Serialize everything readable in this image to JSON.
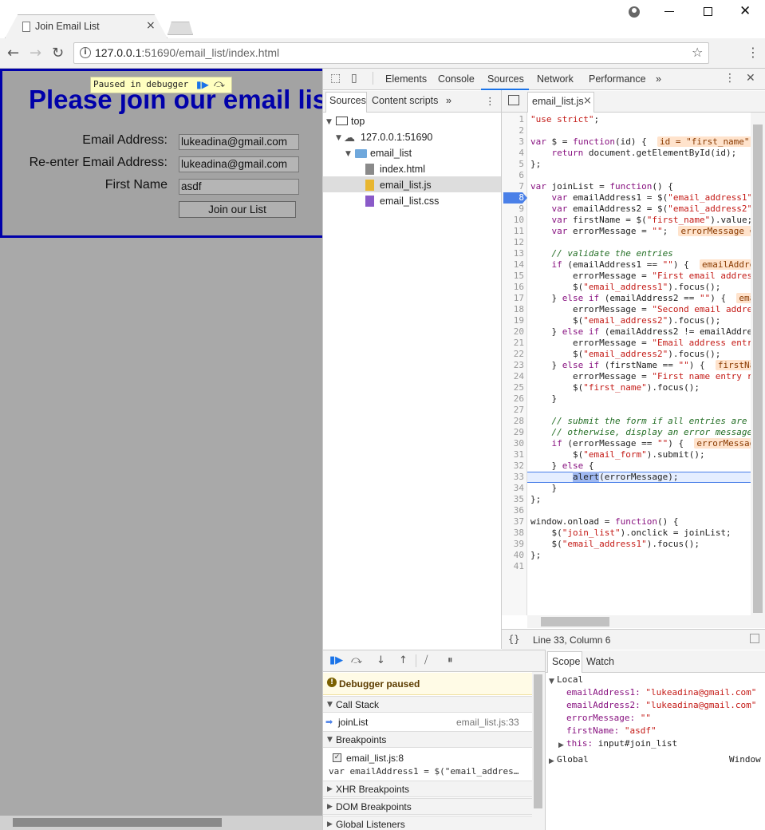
{
  "browser": {
    "tab_title": "Join Email List",
    "tab_close": "×",
    "url_host": "127.0.0.1",
    "url_rest": ":51690/email_list/index.html"
  },
  "page": {
    "heading": "Please join our email list",
    "overlay_text": "Paused in debugger",
    "fields": [
      {
        "label": "Email Address:",
        "value": "lukeadina@gmail.com"
      },
      {
        "label": "Re-enter Email Address:",
        "value": "lukeadina@gmail.com"
      },
      {
        "label": "First Name",
        "value": "asdf"
      }
    ],
    "button": "Join our List"
  },
  "devtools": {
    "tabs": [
      "Elements",
      "Console",
      "Sources",
      "Network",
      "Performance"
    ],
    "active_tab": "Sources",
    "more": "»",
    "navigator_tabs": [
      "Sources",
      "Content scripts"
    ],
    "tree": {
      "top": "top",
      "host": "127.0.0.1:51690",
      "folder": "email_list",
      "files": [
        "index.html",
        "email_list.js",
        "email_list.css"
      ],
      "selected_file": "email_list.js"
    },
    "editor_tab": "email_list.js",
    "editor_tab_close": "×",
    "code_lines": [
      "\"use strict\";",
      "",
      "var $ = function(id) {",
      "    return document.getElementById(id);",
      "};",
      "",
      "var joinList = function() {",
      "    var emailAddress1 = $(\"email_address1\"",
      "    var emailAddress2 = $(\"email_address2\"",
      "    var firstName = $(\"first_name\").value;",
      "    var errorMessage = \"\";",
      "",
      "    // validate the entries",
      "    if (emailAddress1 == \"\") {",
      "        errorMessage = \"First email addres",
      "        $(\"email_address1\").focus();",
      "    } else if (emailAddress2 == \"\") {",
      "        errorMessage = \"Second email addre",
      "        $(\"email_address2\").focus();",
      "    } else if (emailAddress2 != emailAddre",
      "        errorMessage = \"Email address entr",
      "        $(\"email_address2\").focus();",
      "    } else if (firstName == \"\") {",
      "        errorMessage = \"First name entry r",
      "        $(\"first_name\").focus();",
      "    }",
      "",
      "    // submit the form if all entries are",
      "    // otherwise, display an error message",
      "    if (errorMessage == \"\") {",
      "        $(\"email_form\").submit();",
      "    } else {",
      "        alert(errorMessage);",
      "    }",
      "};",
      "",
      "window.onload = function() {",
      "    $(\"join_list\").onclick = joinList;",
      "    $(\"email_address1\").focus();",
      "};",
      ""
    ],
    "inline_values": {
      "line3": "id = \"first_name\"",
      "line11": "errorMessage =",
      "line14": "emailAddre",
      "line17": "ema",
      "line23": "firstNa",
      "line30": "errorMessage"
    },
    "breakpoint_line": 8,
    "execution_line": 33,
    "status": "Line 33, Column 6",
    "pretty_print": "{}",
    "debugger": {
      "paused_label": "Debugger paused",
      "call_stack_label": "Call Stack",
      "frame_name": "joinList",
      "frame_location": "email_list.js:33",
      "breakpoints_label": "Breakpoints",
      "breakpoint_file": "email_list.js:8",
      "breakpoint_code": "var emailAddress1 = $(\"email_addres…",
      "xhr_label": "XHR Breakpoints",
      "dom_label": "DOM Breakpoints",
      "global_label": "Global Listeners"
    },
    "scope": {
      "tabs": [
        "Scope",
        "Watch"
      ],
      "local_label": "Local",
      "vars": [
        {
          "name": "emailAddress1",
          "value": "\"lukeadina@gmail.com\""
        },
        {
          "name": "emailAddress2",
          "value": "\"lukeadina@gmail.com\""
        },
        {
          "name": "errorMessage",
          "value": "\"\""
        },
        {
          "name": "firstName",
          "value": "\"asdf\""
        }
      ],
      "this_label": "this",
      "this_value": "input#join_list",
      "global_label": "Global",
      "global_value": "Window"
    }
  },
  "colors": {
    "heading": "#0000aa",
    "accent": "#1a73e8",
    "page_bg": "#a9a9a9"
  }
}
